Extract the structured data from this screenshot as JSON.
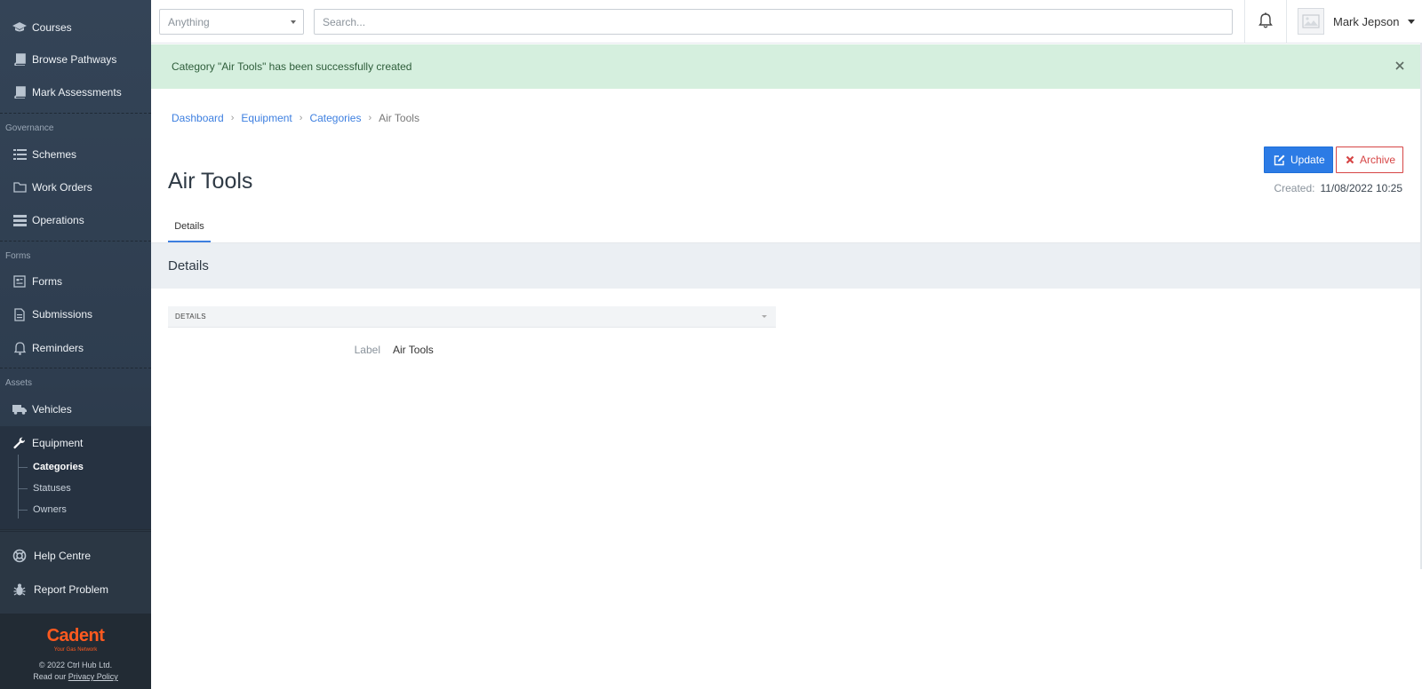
{
  "sidebar": {
    "items_top": [
      {
        "label": "Courses",
        "icon": "graduation-cap-icon"
      },
      {
        "label": "Browse Pathways",
        "icon": "book-icon"
      },
      {
        "label": "Mark Assessments",
        "icon": "book-icon"
      }
    ],
    "sections": {
      "governance": "Governance",
      "forms": "Forms",
      "assets": "Assets"
    },
    "items_governance": [
      {
        "label": "Schemes",
        "icon": "list-icon"
      },
      {
        "label": "Work Orders",
        "icon": "folder-icon"
      },
      {
        "label": "Operations",
        "icon": "server-icon"
      }
    ],
    "items_forms": [
      {
        "label": "Forms",
        "icon": "form-icon"
      },
      {
        "label": "Submissions",
        "icon": "file-icon"
      },
      {
        "label": "Reminders",
        "icon": "bell-icon"
      }
    ],
    "items_assets": [
      {
        "label": "Vehicles",
        "icon": "truck-icon"
      },
      {
        "label": "Equipment",
        "icon": "wrench-icon"
      }
    ],
    "equipment_sub": [
      "Categories",
      "Statuses",
      "Owners"
    ],
    "help": [
      {
        "label": "Help Centre",
        "icon": "life-ring-icon"
      },
      {
        "label": "Report Problem",
        "icon": "bug-icon"
      }
    ],
    "footer": {
      "logo": "Cadent",
      "tagline": "Your Gas Network",
      "copyright": "© 2022 Ctrl Hub Ltd.",
      "read_our": "Read our",
      "privacy": "Privacy Policy"
    }
  },
  "topbar": {
    "filter_value": "Anything",
    "search_placeholder": "Search...",
    "user_name": "Mark Jepson"
  },
  "alert": {
    "message": "Category \"Air Tools\" has been successfully created"
  },
  "breadcrumb": [
    "Dashboard",
    "Equipment",
    "Categories",
    "Air Tools"
  ],
  "page": {
    "title": "Air Tools",
    "update_label": "Update",
    "archive_label": "Archive",
    "created_label": "Created:",
    "created_value": "11/08/2022 10:25",
    "tab": "Details",
    "section_title": "Details",
    "panel_title": "DETAILS",
    "field_label": "Label",
    "field_value": "Air Tools"
  },
  "colors": {
    "sidebar_bg": "#344457",
    "accent": "#2c7be5",
    "danger": "#d64545",
    "alert_bg": "#d5efde",
    "brand": "#ff5a1f"
  }
}
